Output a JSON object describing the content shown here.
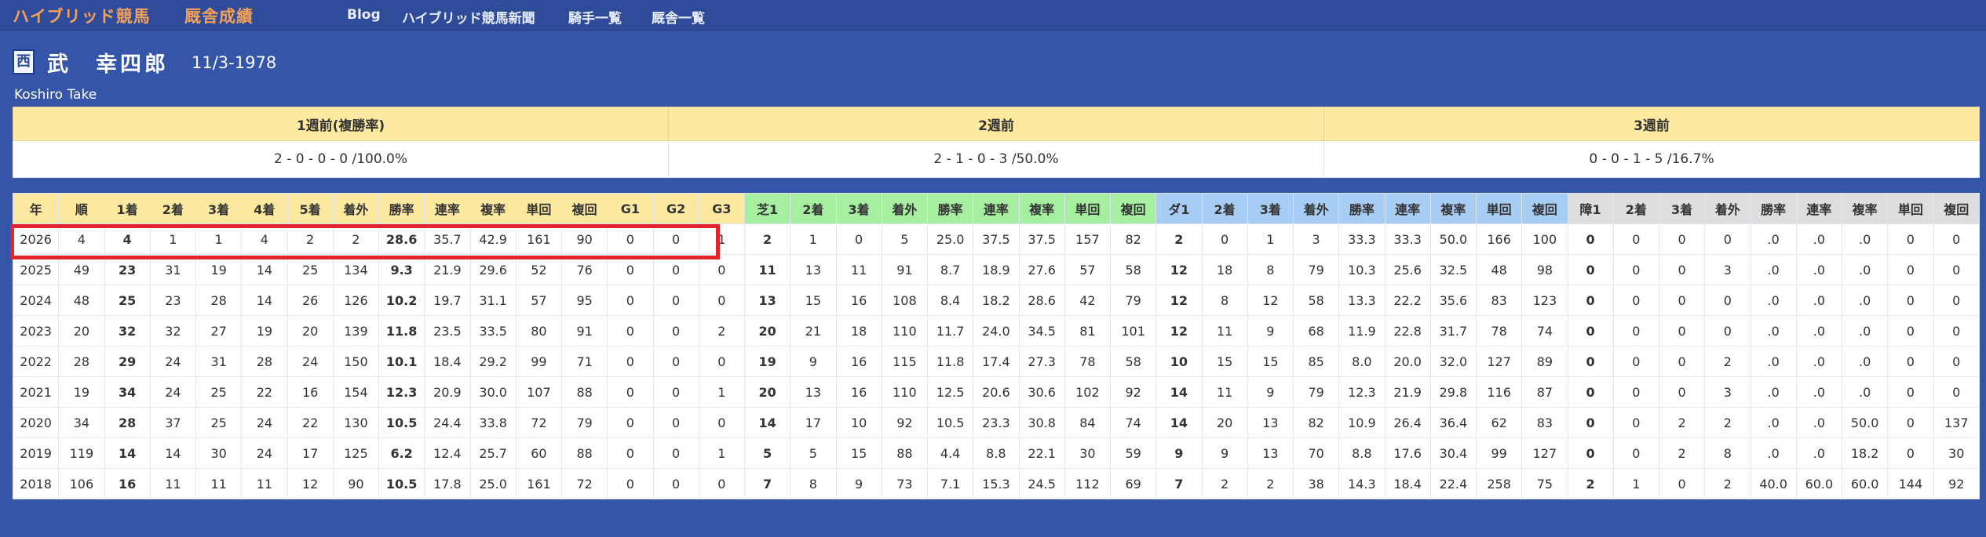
{
  "header": {
    "brand": "ハイブリッド競馬",
    "brand_sub": "厩舎成績",
    "nav": [
      "Blog",
      "ハイブリッド競馬新聞",
      "騎手一覧",
      "厩舎一覧"
    ]
  },
  "jockey": {
    "region": "西",
    "name": "武　幸四郎",
    "birth": "11/3-1978",
    "roman": "Koshiro Take"
  },
  "weeks": {
    "headers": [
      "1週前(複勝率)",
      "2週前",
      "3週前"
    ],
    "values": [
      "2 - 0 - 0 - 0 /100.0%",
      "2 - 1 - 0 - 3 /50.0%",
      "0 - 0 - 1 - 5 /16.7%"
    ]
  },
  "stats": {
    "headers": [
      "年",
      "順",
      "1着",
      "2着",
      "3着",
      "4着",
      "5着",
      "着外",
      "勝率",
      "連率",
      "複率",
      "単回",
      "複回",
      "G1",
      "G2",
      "G3",
      "芝1",
      "2着",
      "3着",
      "着外",
      "勝率",
      "連率",
      "複率",
      "単回",
      "複回",
      "ダ1",
      "2着",
      "3着",
      "着外",
      "勝率",
      "連率",
      "複率",
      "単回",
      "複回",
      "障1",
      "2着",
      "3着",
      "着外",
      "勝率",
      "連率",
      "複率",
      "単回",
      "複回"
    ],
    "rows": [
      [
        "2026",
        "4",
        "4",
        "1",
        "1",
        "4",
        "2",
        "2",
        "28.6",
        "35.7",
        "42.9",
        "161",
        "90",
        "0",
        "0",
        "1",
        "2",
        "1",
        "0",
        "5",
        "25.0",
        "37.5",
        "37.5",
        "157",
        "82",
        "2",
        "0",
        "1",
        "3",
        "33.3",
        "33.3",
        "50.0",
        "166",
        "100",
        "0",
        "0",
        "0",
        "0",
        ".0",
        ".0",
        ".0",
        "0",
        "0"
      ],
      [
        "2025",
        "49",
        "23",
        "31",
        "19",
        "14",
        "25",
        "134",
        "9.3",
        "21.9",
        "29.6",
        "52",
        "76",
        "0",
        "0",
        "0",
        "11",
        "13",
        "11",
        "91",
        "8.7",
        "18.9",
        "27.6",
        "57",
        "58",
        "12",
        "18",
        "8",
        "79",
        "10.3",
        "25.6",
        "32.5",
        "48",
        "98",
        "0",
        "0",
        "0",
        "3",
        ".0",
        ".0",
        ".0",
        "0",
        "0"
      ],
      [
        "2024",
        "48",
        "25",
        "23",
        "28",
        "14",
        "26",
        "126",
        "10.2",
        "19.7",
        "31.1",
        "57",
        "95",
        "0",
        "0",
        "0",
        "13",
        "15",
        "16",
        "108",
        "8.4",
        "18.2",
        "28.6",
        "42",
        "79",
        "12",
        "8",
        "12",
        "58",
        "13.3",
        "22.2",
        "35.6",
        "83",
        "123",
        "0",
        "0",
        "0",
        "0",
        ".0",
        ".0",
        ".0",
        "0",
        "0"
      ],
      [
        "2023",
        "20",
        "32",
        "32",
        "27",
        "19",
        "20",
        "139",
        "11.8",
        "23.5",
        "33.5",
        "80",
        "91",
        "0",
        "0",
        "2",
        "20",
        "21",
        "18",
        "110",
        "11.7",
        "24.0",
        "34.5",
        "81",
        "101",
        "12",
        "11",
        "9",
        "68",
        "11.9",
        "22.8",
        "31.7",
        "78",
        "74",
        "0",
        "0",
        "0",
        "0",
        ".0",
        ".0",
        ".0",
        "0",
        "0"
      ],
      [
        "2022",
        "28",
        "29",
        "24",
        "31",
        "28",
        "24",
        "150",
        "10.1",
        "18.4",
        "29.2",
        "99",
        "71",
        "0",
        "0",
        "0",
        "19",
        "9",
        "16",
        "115",
        "11.8",
        "17.4",
        "27.3",
        "78",
        "58",
        "10",
        "15",
        "15",
        "85",
        "8.0",
        "20.0",
        "32.0",
        "127",
        "89",
        "0",
        "0",
        "0",
        "2",
        ".0",
        ".0",
        ".0",
        "0",
        "0"
      ],
      [
        "2021",
        "19",
        "34",
        "24",
        "25",
        "22",
        "16",
        "154",
        "12.3",
        "20.9",
        "30.0",
        "107",
        "88",
        "0",
        "0",
        "1",
        "20",
        "13",
        "16",
        "110",
        "12.5",
        "20.6",
        "30.6",
        "102",
        "92",
        "14",
        "11",
        "9",
        "79",
        "12.3",
        "21.9",
        "29.8",
        "116",
        "87",
        "0",
        "0",
        "0",
        "3",
        ".0",
        ".0",
        ".0",
        "0",
        "0"
      ],
      [
        "2020",
        "34",
        "28",
        "37",
        "25",
        "24",
        "22",
        "130",
        "10.5",
        "24.4",
        "33.8",
        "72",
        "79",
        "0",
        "0",
        "0",
        "14",
        "17",
        "10",
        "92",
        "10.5",
        "23.3",
        "30.8",
        "84",
        "74",
        "14",
        "20",
        "13",
        "82",
        "10.9",
        "26.4",
        "36.4",
        "62",
        "83",
        "0",
        "0",
        "2",
        "2",
        ".0",
        ".0",
        "50.0",
        "0",
        "137"
      ],
      [
        "2019",
        "119",
        "14",
        "14",
        "30",
        "24",
        "17",
        "125",
        "6.2",
        "12.4",
        "25.7",
        "60",
        "88",
        "0",
        "0",
        "1",
        "5",
        "5",
        "15",
        "88",
        "4.4",
        "8.8",
        "22.1",
        "30",
        "59",
        "9",
        "9",
        "13",
        "70",
        "8.8",
        "17.6",
        "30.4",
        "99",
        "127",
        "0",
        "0",
        "2",
        "8",
        ".0",
        ".0",
        "18.2",
        "0",
        "30"
      ],
      [
        "2018",
        "106",
        "16",
        "11",
        "11",
        "11",
        "12",
        "90",
        "10.5",
        "17.8",
        "25.0",
        "161",
        "72",
        "0",
        "0",
        "0",
        "7",
        "8",
        "9",
        "73",
        "7.1",
        "15.3",
        "24.5",
        "112",
        "69",
        "7",
        "2",
        "2",
        "38",
        "14.3",
        "18.4",
        "22.4",
        "258",
        "75",
        "2",
        "1",
        "0",
        "2",
        "40.0",
        "60.0",
        "60.0",
        "144",
        "92"
      ]
    ]
  }
}
